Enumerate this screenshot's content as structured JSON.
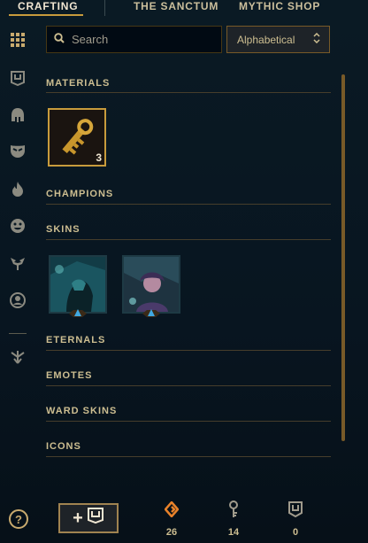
{
  "nav": {
    "tabs": [
      {
        "label": "CRAFTING",
        "active": true
      },
      {
        "label": "THE SANCTUM",
        "active": false
      },
      {
        "label": "MYTHIC SHOP",
        "active": false
      }
    ]
  },
  "sidebar": {
    "items": [
      {
        "icon": "grid-icon"
      },
      {
        "icon": "chest-icon"
      },
      {
        "icon": "helmet-icon"
      },
      {
        "icon": "mask-icon"
      },
      {
        "icon": "fire-icon"
      },
      {
        "icon": "emote-face-icon"
      },
      {
        "icon": "ward-icon"
      },
      {
        "icon": "profile-icon"
      },
      {
        "icon": "arrows-icon"
      }
    ]
  },
  "search": {
    "placeholder": "Search",
    "value": ""
  },
  "sort": {
    "selected": "Alphabetical"
  },
  "sections": {
    "materials": "MATERIALS",
    "champions": "CHAMPIONS",
    "skins": "SKINS",
    "eternals": "ETERNALS",
    "emotes": "EMOTES",
    "ward_skins": "WARD SKINS",
    "icons": "ICONS"
  },
  "materials": [
    {
      "name": "Hextech key",
      "count": "3"
    }
  ],
  "skins": [
    {
      "name": "skin-shard-1",
      "rarity": "epic"
    },
    {
      "name": "skin-shard-2",
      "rarity": "epic"
    }
  ],
  "bottom": {
    "help_label": "?",
    "add_label": "+",
    "currencies": [
      {
        "icon": "orange-essence-icon",
        "value": "26"
      },
      {
        "icon": "key-fragment-icon",
        "value": "14"
      },
      {
        "icon": "chest-currency-icon",
        "value": "0"
      }
    ]
  },
  "colors": {
    "accent": "#c89b3c",
    "background": "#0a1a24",
    "text": "#cdbe91"
  }
}
